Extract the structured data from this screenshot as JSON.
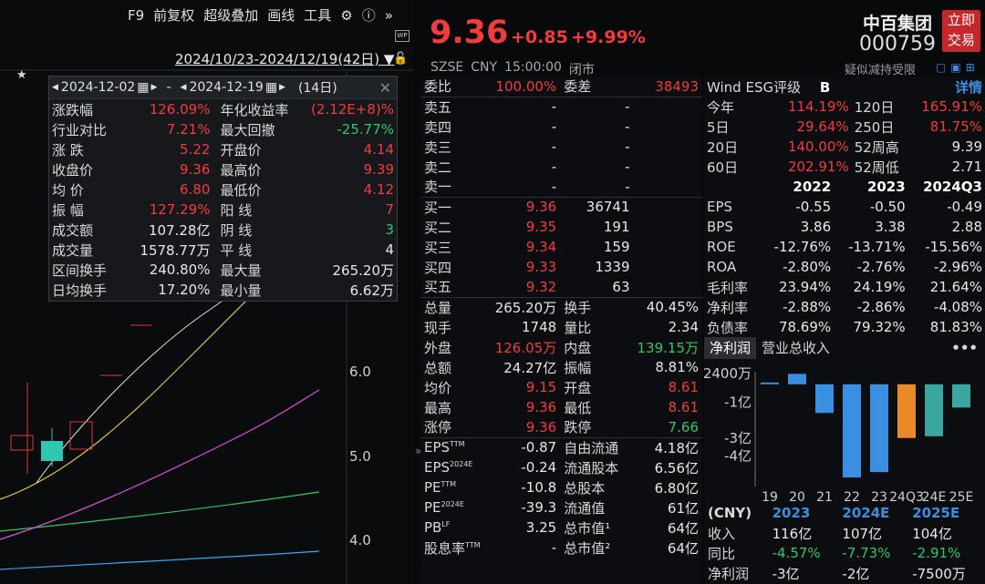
{
  "toolbar": {
    "f9": "F9",
    "fuquan": "前复权",
    "diejia": "超级叠加",
    "huaxian": "画线",
    "gongju": "工具"
  },
  "range_label": "2024/10/23-2024/12/19(42日)",
  "overlay": {
    "start": "2024-12-02",
    "dash": "-",
    "end": "2024-12-19",
    "days": "(14日)",
    "rows": [
      {
        "l1": "涨跌幅",
        "v1": "126.09%",
        "c1": "red",
        "l2": "年化收益率",
        "v2": "(2.12E+8)%",
        "c2": "red"
      },
      {
        "l1": "行业对比",
        "v1": "7.21%",
        "c1": "red",
        "l2": "最大回撤",
        "v2": "-25.77%",
        "c2": "green"
      },
      {
        "l1": "涨 跌",
        "v1": "5.22",
        "c1": "red",
        "l2": "开盘价",
        "v2": "4.14",
        "c2": "red"
      },
      {
        "l1": "收盘价",
        "v1": "9.36",
        "c1": "red",
        "l2": "最高价",
        "v2": "9.39",
        "c2": "red"
      },
      {
        "l1": "均 价",
        "v1": "6.80",
        "c1": "red",
        "l2": "最低价",
        "v2": "4.12",
        "c2": "red"
      },
      {
        "l1": "振 幅",
        "v1": "127.29%",
        "c1": "red",
        "l2": "阳 线",
        "v2": "7",
        "c2": "red"
      },
      {
        "l1": "成交额",
        "v1": "107.28亿",
        "c1": "white",
        "l2": "阴 线",
        "v2": "3",
        "c2": "green"
      },
      {
        "l1": "成交量",
        "v1": "1578.77万",
        "c1": "white",
        "l2": "平 线",
        "v2": "4",
        "c2": "white"
      },
      {
        "l1": "区间换手",
        "v1": "240.80%",
        "c1": "white",
        "l2": "最大量",
        "v2": "265.20万",
        "c2": "white"
      },
      {
        "l1": "日均换手",
        "v1": "17.20%",
        "c1": "white",
        "l2": "最小量",
        "v2": "6.62万",
        "c2": "white"
      }
    ]
  },
  "yaxis": [
    "6.0",
    "5.0",
    "4.0"
  ],
  "quote": {
    "price": "9.36",
    "change": "+0.85",
    "pct": "+9.99%",
    "exchange": "SZSE",
    "currency": "CNY",
    "time": "15:00:00",
    "status": "闭市"
  },
  "stock": {
    "name": "中百集团",
    "code": "000759",
    "trade_btn1": "立即",
    "trade_btn2": "交易",
    "notice": "疑似减持受限"
  },
  "orderbook": {
    "weibi_l": "委比",
    "weibi_v": "100.00%",
    "weicha_l": "委差",
    "weicha_v": "38493",
    "sells": [
      {
        "l": "卖五",
        "p": "-",
        "q": "-"
      },
      {
        "l": "卖四",
        "p": "-",
        "q": "-"
      },
      {
        "l": "卖三",
        "p": "-",
        "q": "-"
      },
      {
        "l": "卖二",
        "p": "-",
        "q": "-"
      },
      {
        "l": "卖一",
        "p": "-",
        "q": "-"
      }
    ],
    "buys": [
      {
        "l": "买一",
        "p": "9.36",
        "q": "36741"
      },
      {
        "l": "买二",
        "p": "9.35",
        "q": "191"
      },
      {
        "l": "买三",
        "p": "9.34",
        "q": "159"
      },
      {
        "l": "买四",
        "p": "9.33",
        "q": "1339"
      },
      {
        "l": "买五",
        "p": "9.32",
        "q": "63"
      }
    ]
  },
  "stats": [
    {
      "l1": "总量",
      "v1": "265.20万",
      "c1": "white",
      "l2": "换手",
      "v2": "40.45%",
      "c2": "white"
    },
    {
      "l1": "现手",
      "v1": "1748",
      "c1": "white",
      "l2": "量比",
      "v2": "2.34",
      "c2": "white"
    },
    {
      "l1": "外盘",
      "v1": "126.05万",
      "c1": "red",
      "l2": "内盘",
      "v2": "139.15万",
      "c2": "green"
    },
    {
      "l1": "总额",
      "v1": "24.27亿",
      "c1": "white",
      "l2": "振幅",
      "v2": "8.81%",
      "c2": "white"
    },
    {
      "l1": "均价",
      "v1": "9.15",
      "c1": "red",
      "l2": "开盘",
      "v2": "8.61",
      "c2": "red"
    },
    {
      "l1": "最高",
      "v1": "9.36",
      "c1": "red",
      "l2": "最低",
      "v2": "8.61",
      "c2": "red"
    },
    {
      "l1": "涨停",
      "v1": "9.36",
      "c1": "red",
      "l2": "跌停",
      "v2": "7.66",
      "c2": "green"
    }
  ],
  "fundamentals": [
    {
      "l1": "EPS",
      "s1": "TTM",
      "v1": "-0.87",
      "l2": "自由流通",
      "v2": "4.18亿"
    },
    {
      "l1": "EPS",
      "s1": "2024E",
      "v1": "-0.24",
      "l2": "流通股本",
      "v2": "6.56亿"
    },
    {
      "l1": "PE",
      "s1": "TTM",
      "v1": "-10.8",
      "l2": "总股本",
      "v2": "6.80亿"
    },
    {
      "l1": "PE",
      "s1": "2024E",
      "v1": "-39.3",
      "l2": "流通值",
      "v2": "61亿"
    },
    {
      "l1": "PB",
      "s1": "LF",
      "v1": "3.25",
      "l2": "总市值¹",
      "v2": "64亿"
    },
    {
      "l1": "股息率",
      "s1": "TTM",
      "v1": "-",
      "l2": "总市值²",
      "v2": "64亿"
    }
  ],
  "esg": {
    "label": "Wind ESG评级",
    "grade": "B",
    "detail": "详情"
  },
  "perf": [
    {
      "l1": "今年",
      "v1": "114.19%",
      "l2": "120日",
      "v2": "165.91%"
    },
    {
      "l1": "5日",
      "v1": "29.64%",
      "l2": "250日",
      "v2": "81.75%"
    },
    {
      "l1": "20日",
      "v1": "140.00%",
      "l2": "52周高",
      "v2": "9.39"
    },
    {
      "l1": "60日",
      "v1": "202.91%",
      "l2": "52周低",
      "v2": "2.71"
    }
  ],
  "fin": {
    "years": [
      "2022",
      "2023",
      "2024Q3"
    ],
    "rows": [
      {
        "l": "EPS",
        "v": [
          "-0.55",
          "-0.50",
          "-0.49"
        ]
      },
      {
        "l": "BPS",
        "v": [
          "3.86",
          "3.38",
          "2.88"
        ]
      },
      {
        "l": "ROE",
        "v": [
          "-12.76%",
          "-13.71%",
          "-15.56%"
        ]
      },
      {
        "l": "ROA",
        "v": [
          "-2.80%",
          "-2.76%",
          "-2.96%"
        ]
      },
      {
        "l": "毛利率",
        "v": [
          "23.94%",
          "24.19%",
          "21.64%"
        ]
      },
      {
        "l": "净利率",
        "v": [
          "-2.88%",
          "-2.86%",
          "-4.08%"
        ]
      },
      {
        "l": "负债率",
        "v": [
          "78.69%",
          "79.32%",
          "81.83%"
        ]
      }
    ]
  },
  "tabs": {
    "t1": "净利润",
    "t2": "营业总收入",
    "more": "•••"
  },
  "chart_data": {
    "type": "bar",
    "categories": [
      "19",
      "20",
      "21",
      "22",
      "23",
      "24Q3",
      "24E",
      "25E"
    ],
    "values": [
      100,
      580,
      -1600,
      -5200,
      -4900,
      -3000,
      -2900,
      -1300
    ],
    "yticks": [
      "2400万",
      "-1亿",
      "-3亿",
      "-4亿"
    ],
    "colors": [
      "#3b8fe0",
      "#3b8fe0",
      "#3b8fe0",
      "#3b8fe0",
      "#3b8fe0",
      "#e8892a",
      "#3aa6a0",
      "#3aa6a0"
    ]
  },
  "fcst": {
    "unit": "(CNY)",
    "years": [
      "2023",
      "2024E",
      "2025E"
    ],
    "rows": [
      {
        "l": "收入",
        "v": [
          "116亿",
          "107亿",
          "104亿"
        ],
        "c": [
          "white",
          "white",
          "white"
        ]
      },
      {
        "l": "同比",
        "v": [
          "-4.57%",
          "-7.73%",
          "-2.91%"
        ],
        "c": [
          "green",
          "green",
          "green"
        ]
      },
      {
        "l": "净利润",
        "v": [
          "-3亿",
          "-2亿",
          "-7500万"
        ],
        "c": [
          "white",
          "white",
          "white"
        ]
      }
    ]
  }
}
